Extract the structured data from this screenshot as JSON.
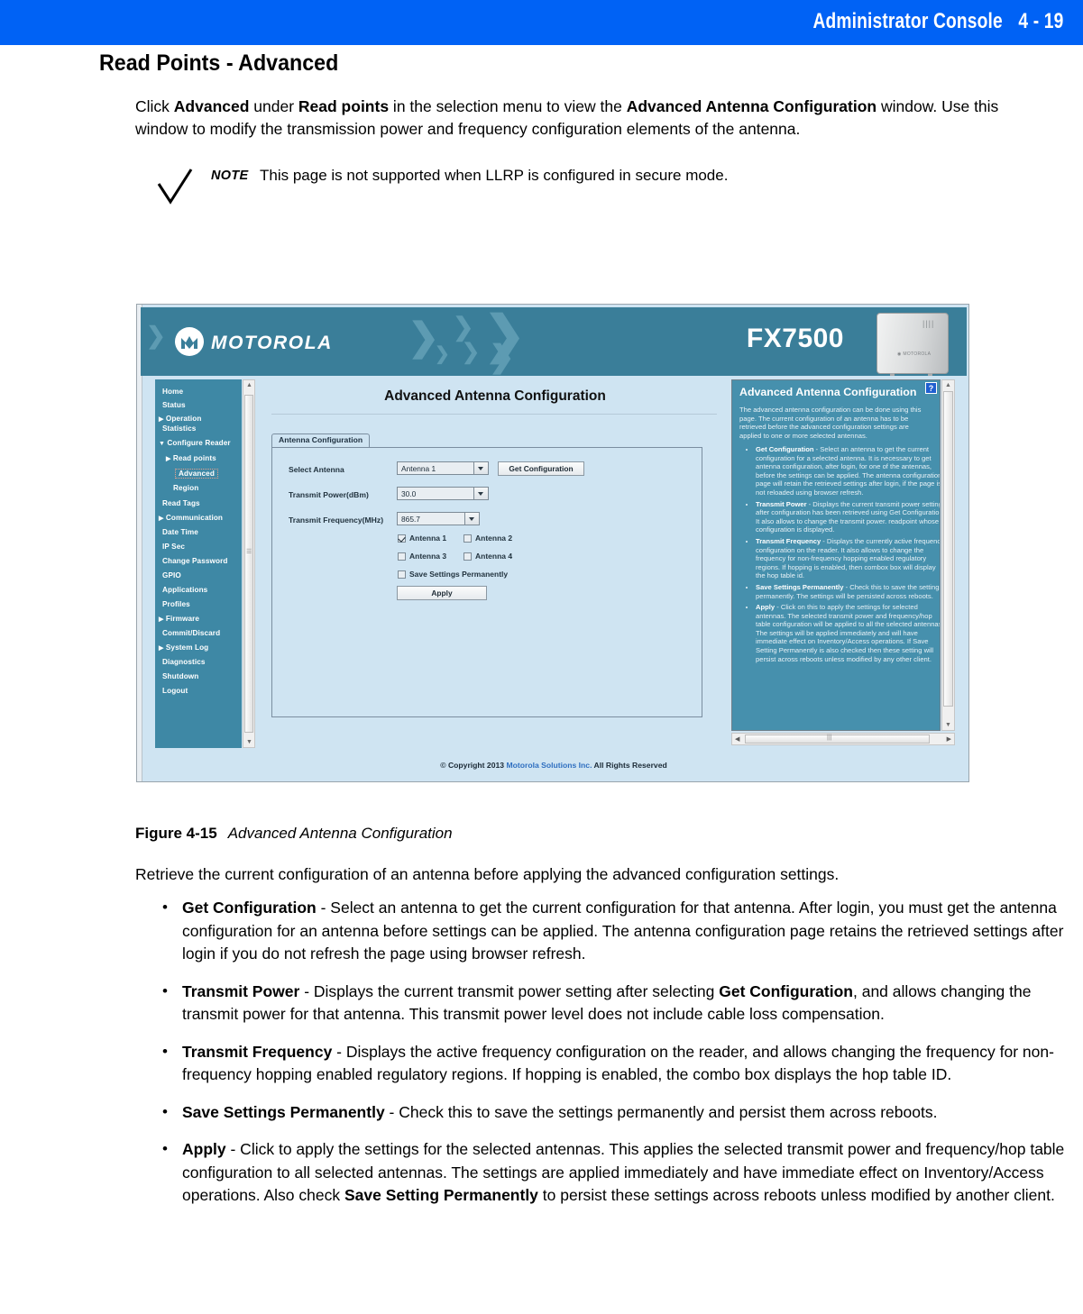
{
  "header": {
    "title": "Administrator Console",
    "page_number": "4 - 19",
    "bar_color": "#0062f5"
  },
  "doc": {
    "section_title": "Read Points - Advanced",
    "intro_before": "Click ",
    "intro_b1": "Advanced",
    "intro_mid1": " under ",
    "intro_b2": "Read points",
    "intro_mid2": " in the selection menu to view the ",
    "intro_b3": "Advanced Antenna Configuration",
    "intro_after": " window. Use this window to modify the transmission power and frequency configuration elements of the antenna.",
    "note_label": "NOTE",
    "note_text": "This page is not supported when LLRP is configured in secure mode.",
    "figure_number": "Figure 4-15",
    "figure_title": "Advanced Antenna Configuration",
    "lead": "Retrieve the current configuration of an antenna before applying the advanced configuration settings."
  },
  "doc_bullets": [
    {
      "term": "Get Configuration",
      "text_1": " - Select an antenna to get the current configuration for that antenna. After login, you must get the antenna configuration for an antenna before settings can be applied. The antenna configuration page retains the retrieved settings after login if you do not refresh the page using browser refresh."
    },
    {
      "term": "Transmit Power",
      "text_1": " - Displays the current transmit power setting after selecting ",
      "term_2": "Get Configuration",
      "text_2": ", and allows changing the transmit power for that antenna. This transmit power level does not include cable loss compensation."
    },
    {
      "term": "Transmit Frequency",
      "text_1": " - Displays the active frequency configuration on the reader, and allows changing the frequency for non-frequency hopping enabled regulatory regions. If hopping is enabled, the combo box displays the hop table ID."
    },
    {
      "term": "Save Settings Permanently",
      "text_1": " - Check this to save the settings permanently and persist them across reboots."
    },
    {
      "term": "Apply",
      "text_1": " - Click to apply the settings for the selected antennas. This applies the selected transmit power and frequency/hop table configuration to all selected antennas. The settings are applied immediately and have immediate effect on Inventory/Access operations. Also check ",
      "term_2": "Save Setting Permanently",
      "text_2": " to persist these settings across reboots unless modified by another client."
    }
  ],
  "screenshot": {
    "banner": {
      "brand": "MOTOROLA",
      "model": "FX7500",
      "teal": "#3a7e99"
    },
    "sidebar": {
      "items": [
        {
          "label": "Home",
          "indent": 0,
          "arrow": ""
        },
        {
          "label": "Status",
          "indent": 0,
          "arrow": ""
        },
        {
          "label": "Operation",
          "indent": 0,
          "arrow": "▶"
        },
        {
          "label": "Statistics",
          "indent": 0,
          "arrow": ""
        },
        {
          "label": "Configure Reader",
          "indent": 0,
          "arrow": "▼"
        },
        {
          "label": "Read points",
          "indent": 1,
          "arrow": "▶"
        },
        {
          "label": "Advanced",
          "indent": 2,
          "arrow": "",
          "selected": true
        },
        {
          "label": "Region",
          "indent": 1,
          "arrow": ""
        },
        {
          "label": "Read Tags",
          "indent": 0,
          "arrow": ""
        },
        {
          "label": "Communication",
          "indent": 0,
          "arrow": "▶"
        },
        {
          "label": "Date Time",
          "indent": 0,
          "arrow": ""
        },
        {
          "label": "IP Sec",
          "indent": 0,
          "arrow": ""
        },
        {
          "label": "Change Password",
          "indent": 0,
          "arrow": ""
        },
        {
          "label": "GPIO",
          "indent": 0,
          "arrow": ""
        },
        {
          "label": "Applications",
          "indent": 0,
          "arrow": ""
        },
        {
          "label": "Profiles",
          "indent": 0,
          "arrow": ""
        },
        {
          "label": "Firmware",
          "indent": 0,
          "arrow": "▶"
        },
        {
          "label": "Commit/Discard",
          "indent": 0,
          "arrow": ""
        },
        {
          "label": "System Log",
          "indent": 0,
          "arrow": "▶"
        },
        {
          "label": "Diagnostics",
          "indent": 0,
          "arrow": ""
        },
        {
          "label": "Shutdown",
          "indent": 0,
          "arrow": ""
        },
        {
          "label": "Logout",
          "indent": 0,
          "arrow": ""
        }
      ]
    },
    "main": {
      "title": "Advanced Antenna Configuration",
      "tab_label": "Antenna Configuration",
      "fields": {
        "select_antenna_label": "Select Antenna",
        "select_antenna_value": "Antenna 1",
        "get_config_button": "Get Configuration",
        "transmit_power_label": "Transmit Power(dBm)",
        "transmit_power_value": "30.0",
        "transmit_frequency_label": "Transmit Frequency(MHz)",
        "transmit_frequency_value": "865.7"
      },
      "checkboxes": [
        {
          "label": "Antenna 1",
          "checked": true
        },
        {
          "label": "Antenna 2",
          "checked": false
        },
        {
          "label": "Antenna 3",
          "checked": false
        },
        {
          "label": "Antenna 4",
          "checked": false
        },
        {
          "label": "Save Settings Permanently",
          "checked": false
        }
      ],
      "apply_button": "Apply"
    },
    "help": {
      "title": "Advanced Antenna Configuration",
      "help_icon": "?",
      "intro": "The advanced antenna configuration can be done using this page. The current configuration of an antenna has to be retrieved before the advanced configuration settings are applied to one or more selected antennas.",
      "items": [
        {
          "term": "Get Configuration",
          "text": " - Select an antenna to get the current configuration for a selected antenna. It is necessary to get antenna configuration, after login, for one of the antennas, before the settings can be applied. The antenna configuration page will retain the retrieved settings after login, if the page is not reloaded using browser refresh."
        },
        {
          "term": "Transmit Power",
          "text": " - Displays the current transmit power setting after configuration has been retrieved using Get Configuration. It also allows to change the transmit power. readpoint whose configuration is displayed."
        },
        {
          "term": "Transmit Frequency",
          "text": " - Displays the currently active frequency configuration on the reader. It also allows to change the frequency for non-frequency hopping enabled regulatory regions. If hopping is enabled, then combox box will display the hop table id."
        },
        {
          "term": "Save Settings Permanently",
          "text": " - Check this to save the settings permanently. The settings will be persisted across reboots."
        },
        {
          "term": "Apply",
          "text": " - Click on this to apply the settings for selected antennas. The selected transmit power and frequency/hop table configuration will be applied to all the selected antennas. The settings will be applied immediately and will have immediate effect on Inventory/Access operations. If Save Setting Permanently is also checked then these setting will persist across reboots unless modified by any other client."
        }
      ]
    },
    "footer": {
      "copyright_pre": "© Copyright 2013 ",
      "copyright_link": "Motorola Solutions Inc.",
      "copyright_post": " All Rights Reserved"
    }
  }
}
